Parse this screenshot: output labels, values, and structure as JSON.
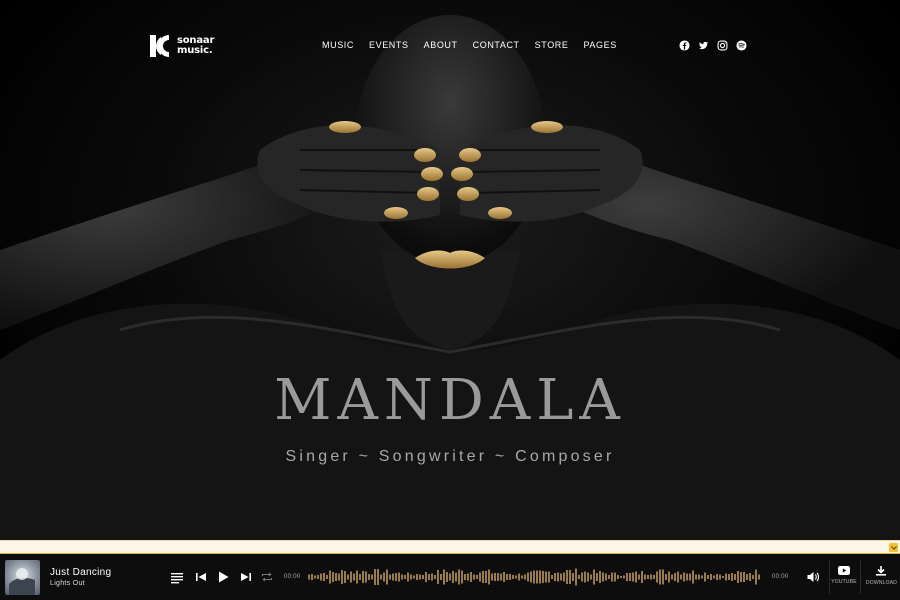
{
  "brand": {
    "line1": "sonaar",
    "line2": "music."
  },
  "nav": {
    "items": [
      {
        "label": "MUSIC"
      },
      {
        "label": "EVENTS"
      },
      {
        "label": "ABOUT"
      },
      {
        "label": "CONTACT"
      },
      {
        "label": "STORE"
      },
      {
        "label": "PAGES"
      }
    ]
  },
  "social": {
    "icons": [
      "facebook-icon",
      "twitter-icon",
      "instagram-icon",
      "spotify-icon"
    ]
  },
  "hero": {
    "title": "MANDALA",
    "subtitle": "Singer ~ Songwriter ~ Composer"
  },
  "player": {
    "track_title": "Just Dancing",
    "artist": "Lights Out",
    "time_current": "00:00",
    "time_total": "00:00",
    "youtube_label": "YOUTUBE",
    "download_label": "DOWNLOAD"
  },
  "colors": {
    "accent_gold": "#c9a35a",
    "strip_bg": "#fdf6e8",
    "strip_toggle": "#f2c230",
    "player_bg": "#0d0d0d",
    "title_gray": "#9a9a9a"
  }
}
